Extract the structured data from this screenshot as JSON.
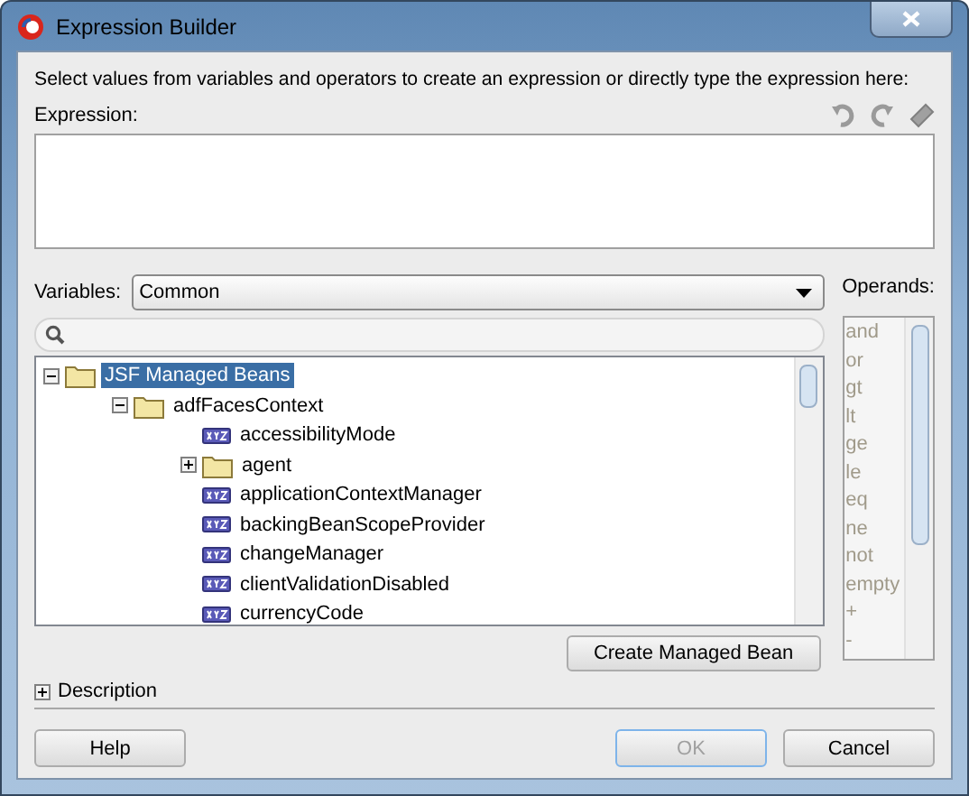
{
  "window": {
    "title": "Expression Builder"
  },
  "instructions": "Select values from variables and operators to create an expression or directly type the expression here:",
  "expression": {
    "label": "Expression:"
  },
  "variables": {
    "label": "Variables:",
    "value": "Common"
  },
  "tree": [
    {
      "label": "JSF Managed Beans",
      "kind": "folder",
      "expanded": true,
      "selected": true,
      "children": [
        {
          "label": "adfFacesContext",
          "kind": "folder",
          "expanded": true,
          "selected": false,
          "children": [
            {
              "label": "accessibilityMode",
              "kind": "property",
              "selected": false
            },
            {
              "label": "agent",
              "kind": "folder",
              "expanded": false,
              "selected": false
            },
            {
              "label": "applicationContextManager",
              "kind": "property",
              "selected": false
            },
            {
              "label": "backingBeanScopeProvider",
              "kind": "property",
              "selected": false
            },
            {
              "label": "changeManager",
              "kind": "property",
              "selected": false
            },
            {
              "label": "clientValidationDisabled",
              "kind": "property",
              "selected": false
            },
            {
              "label": "currencyCode",
              "kind": "property",
              "selected": false
            }
          ]
        }
      ]
    }
  ],
  "operands": {
    "label": "Operands:",
    "disabled": true,
    "items": [
      "and",
      "or",
      "gt",
      "lt",
      "ge",
      "le",
      "eq",
      "ne",
      "not",
      "empty",
      "+",
      "-"
    ]
  },
  "create_button": {
    "label": "Create Managed Bean"
  },
  "description": {
    "label": "Description",
    "expanded": false
  },
  "buttons": [
    {
      "label": "Help",
      "disabled": false
    },
    {
      "label": "OK",
      "disabled": true
    },
    {
      "label": "Cancel",
      "disabled": false
    }
  ]
}
